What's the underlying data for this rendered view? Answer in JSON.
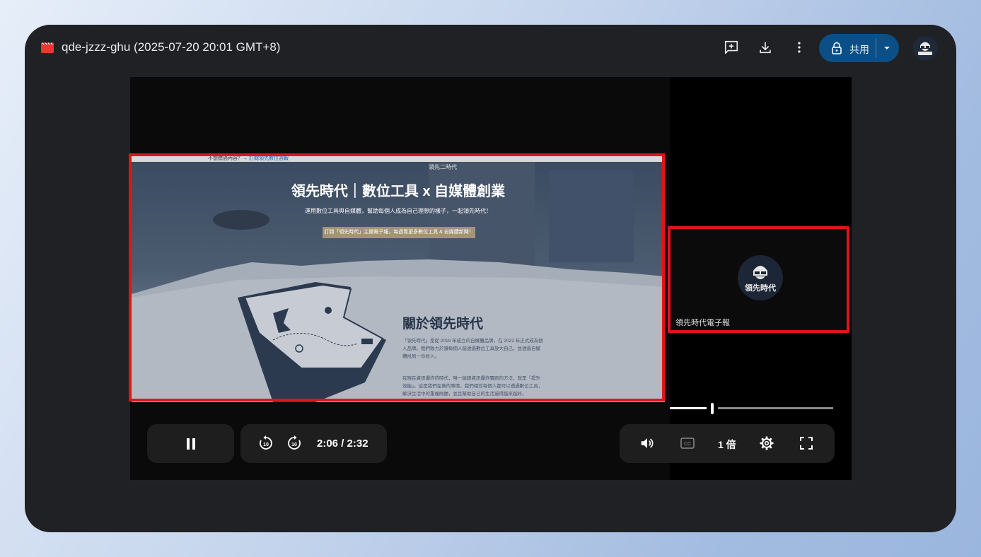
{
  "window": {
    "title": "qde-jzzz-ghu (2025-07-20 20:01 GMT+8)",
    "share_label": "共用",
    "accent_color": "#0b4f86",
    "highlight_color": "#e0141e"
  },
  "toolbar": {
    "add_comment_icon": "add-comment-icon",
    "download_icon": "download-icon",
    "more_icon": "more-vert-icon",
    "lock_icon": "lock-icon",
    "share_dropdown_icon": "arrow-drop-down-icon"
  },
  "screen_share": {
    "topbar_text": "不想錯過內容？→",
    "topbar_link": "訂閱領先數位週報",
    "logo_text": "領先二時代",
    "hero_title": "領先時代｜數位工具 x 自媒體創業",
    "hero_subtitle": "運用數位工具與自媒體，幫助每個人成為自己理想的樣子，一起領先時代！",
    "cta_label": "訂閱「領先時代」主題電子報，每週看更多數位工具 & 自媒體新聞！",
    "about_heading": "關於領先時代",
    "about_para1": "「領先時代」是從 2019 年成立的自媒體品牌，在 2022 年正式成為個人品牌。我們致力於讓每個人能透過數位工具放大自己，並透過自媒體找到一份收入。",
    "about_para2": "在現在資訊爆炸的時代，唯一能跟資訊爆炸賽跑的方法，就是「提升效能」。這是我們在做的事情，我們相信每個人都可以透過數位工具，解決生活中的重複問題，並且幫助自己的生活過得越來越好。"
  },
  "participant": {
    "name": "領先時代電子報",
    "avatar_text": "領先時代"
  },
  "player": {
    "current_time": "2:06",
    "separator": "/",
    "duration": "2:32",
    "progress_fraction": 0.83,
    "speed_label": "1 倍",
    "pause_icon": "pause-icon",
    "rewind_icon": "replay-10-icon",
    "forward_icon": "forward-10-icon",
    "volume_icon": "volume-up-icon",
    "captions_icon": "closed-caption-icon",
    "settings_icon": "settings-gear-icon",
    "fullscreen_icon": "fullscreen-icon"
  }
}
